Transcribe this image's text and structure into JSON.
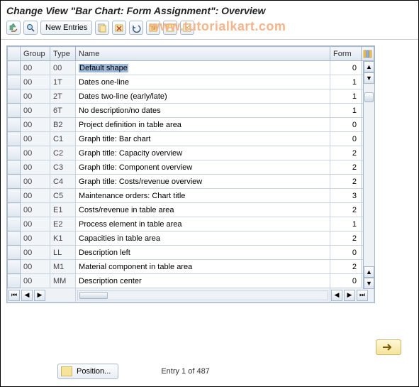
{
  "title": "Change View \"Bar Chart: Form Assignment\": Overview",
  "watermark": "www.tutorialkart.com",
  "toolbar": {
    "new_entries": "New Entries"
  },
  "columns": {
    "group": "Group",
    "type": "Type",
    "name": "Name",
    "form": "Form"
  },
  "rows": [
    {
      "group": "00",
      "type": "00",
      "name": "Default shape",
      "form": "0",
      "selected": true
    },
    {
      "group": "00",
      "type": "1T",
      "name": "Dates one-line",
      "form": "1"
    },
    {
      "group": "00",
      "type": "2T",
      "name": "Dates two-line (early/late)",
      "form": "1"
    },
    {
      "group": "00",
      "type": "6T",
      "name": "No description/no dates",
      "form": "1"
    },
    {
      "group": "00",
      "type": "B2",
      "name": "Project definition in table area",
      "form": "0"
    },
    {
      "group": "00",
      "type": "C1",
      "name": "Graph title: Bar chart",
      "form": "0"
    },
    {
      "group": "00",
      "type": "C2",
      "name": "Graph title: Capacity overview",
      "form": "2"
    },
    {
      "group": "00",
      "type": "C3",
      "name": "Graph title: Component overview",
      "form": "2"
    },
    {
      "group": "00",
      "type": "C4",
      "name": "Graph title: Costs/revenue overview",
      "form": "2"
    },
    {
      "group": "00",
      "type": "C5",
      "name": "Maintenance orders: Chart title",
      "form": "3"
    },
    {
      "group": "00",
      "type": "E1",
      "name": "Costs/revenue in table area",
      "form": "2"
    },
    {
      "group": "00",
      "type": "E2",
      "name": "Process element in table area",
      "form": "1"
    },
    {
      "group": "00",
      "type": "K1",
      "name": "Capacities in table area",
      "form": "2"
    },
    {
      "group": "00",
      "type": "LL",
      "name": "Description left",
      "form": "0"
    },
    {
      "group": "00",
      "type": "M1",
      "name": "Material component in table area",
      "form": "2"
    },
    {
      "group": "00",
      "type": "MM",
      "name": "Description center",
      "form": "0"
    }
  ],
  "position_label": "Position...",
  "entry_status": "Entry 1 of 487"
}
